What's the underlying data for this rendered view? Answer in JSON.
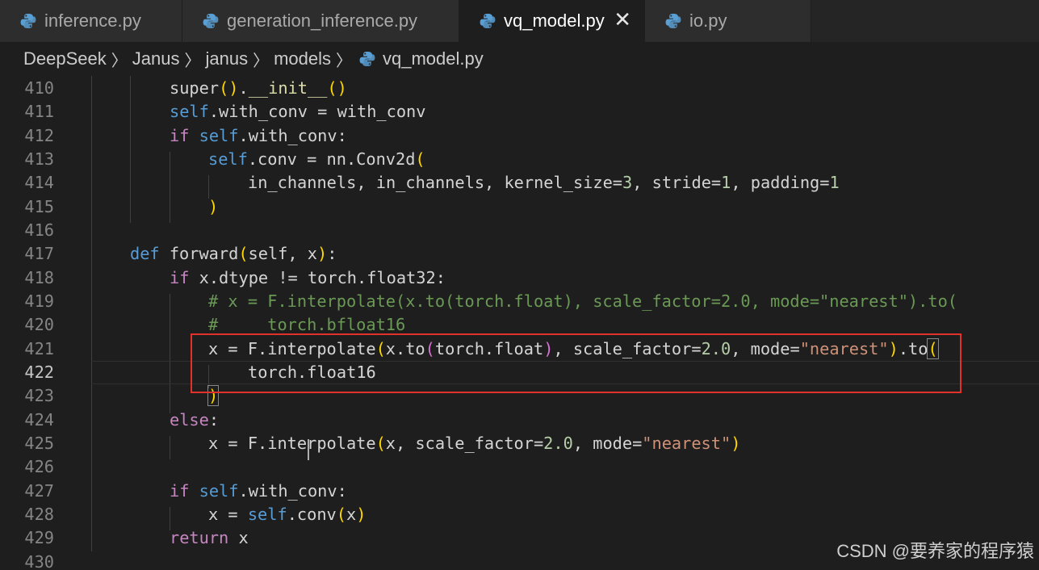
{
  "tabs": [
    {
      "label": "inference.py",
      "active": false
    },
    {
      "label": "generation_inference.py",
      "active": false
    },
    {
      "label": "vq_model.py",
      "active": true,
      "close": "✕"
    },
    {
      "label": "io.py",
      "active": false
    }
  ],
  "breadcrumb": [
    "DeepSeek",
    "Janus",
    "janus",
    "models",
    "vq_model.py"
  ],
  "icons": {
    "python_file": "python-file-icon",
    "chevron": "chevron-right-icon"
  },
  "editor": {
    "current_line": "422",
    "lines": [
      {
        "n": "410",
        "tokens": [
          [
            "p",
            "super"
          ],
          [
            "b1",
            "()"
          ],
          [
            "p",
            "."
          ],
          [
            "fn",
            "__init__"
          ],
          [
            "b1",
            "()"
          ]
        ]
      },
      {
        "n": "411",
        "tokens": [
          [
            "kw",
            "self"
          ],
          [
            "p",
            ".with_conv = with_conv"
          ]
        ]
      },
      {
        "n": "412",
        "tokens": [
          [
            "ctl",
            "if "
          ],
          [
            "kw",
            "self"
          ],
          [
            "p",
            ".with_conv:"
          ]
        ]
      },
      {
        "n": "413",
        "tokens": [
          [
            "kw",
            "self"
          ],
          [
            "p",
            ".conv = nn.Conv2d"
          ],
          [
            "b1",
            "("
          ]
        ]
      },
      {
        "n": "414",
        "tokens": [
          [
            "p",
            "in_channels, in_channels, kernel_size="
          ],
          [
            "num",
            "3"
          ],
          [
            "p",
            ", stride="
          ],
          [
            "num",
            "1"
          ],
          [
            "p",
            ", padding="
          ],
          [
            "num",
            "1"
          ]
        ]
      },
      {
        "n": "415",
        "tokens": [
          [
            "b1",
            ")"
          ]
        ]
      },
      {
        "n": "416",
        "tokens": []
      },
      {
        "n": "417",
        "tokens": [
          [
            "kw",
            "def "
          ],
          [
            "p",
            "forward"
          ],
          [
            "b1",
            "("
          ],
          [
            "p",
            "self, x"
          ],
          [
            "b1",
            ")"
          ],
          [
            "p",
            ":"
          ]
        ]
      },
      {
        "n": "418",
        "tokens": [
          [
            "ctl",
            "if "
          ],
          [
            "p",
            "x.dtype != torch.float32:"
          ]
        ]
      },
      {
        "n": "419",
        "tokens": [
          [
            "cmt",
            "# x = F.interpolate(x.to(torch.float), scale_factor=2.0, mode=\"nearest\").to("
          ]
        ]
      },
      {
        "n": "420",
        "tokens": [
          [
            "cmt",
            "#     torch.bfloat16"
          ]
        ]
      },
      {
        "n": "421",
        "tokens": [
          [
            "p",
            "x = F.interpolate"
          ],
          [
            "b1",
            "("
          ],
          [
            "p",
            "x.to"
          ],
          [
            "b2",
            "("
          ],
          [
            "p",
            "torch.float"
          ],
          [
            "b2",
            ")"
          ],
          [
            "p",
            ", scale_factor="
          ],
          [
            "num",
            "2.0"
          ],
          [
            "p",
            ", mode="
          ],
          [
            "str",
            "\"nearest\""
          ],
          [
            "b1",
            ")"
          ],
          [
            "p",
            ".to"
          ],
          [
            "b1m",
            "("
          ]
        ]
      },
      {
        "n": "422",
        "tokens": [
          [
            "p",
            "torch.float16"
          ]
        ]
      },
      {
        "n": "423",
        "tokens": [
          [
            "b1m",
            ")"
          ]
        ]
      },
      {
        "n": "424",
        "tokens": [
          [
            "ctl",
            "else"
          ],
          [
            "p",
            ":"
          ]
        ]
      },
      {
        "n": "425",
        "tokens": [
          [
            "p",
            "x = F.interpolate"
          ],
          [
            "b1",
            "("
          ],
          [
            "p",
            "x, scale_factor="
          ],
          [
            "num",
            "2.0"
          ],
          [
            "p",
            ", mode="
          ],
          [
            "str",
            "\"nearest\""
          ],
          [
            "b1",
            ")"
          ]
        ]
      },
      {
        "n": "426",
        "tokens": []
      },
      {
        "n": "427",
        "tokens": [
          [
            "ctl",
            "if "
          ],
          [
            "kw",
            "self"
          ],
          [
            "p",
            ".with_conv:"
          ]
        ]
      },
      {
        "n": "428",
        "tokens": [
          [
            "p",
            "x = "
          ],
          [
            "kw",
            "self"
          ],
          [
            "p",
            ".conv"
          ],
          [
            "b1",
            "("
          ],
          [
            "p",
            "x"
          ],
          [
            "b1",
            ")"
          ]
        ]
      },
      {
        "n": "429",
        "tokens": [
          [
            "ctl",
            "return "
          ],
          [
            "p",
            "x"
          ]
        ]
      },
      {
        "n": "430",
        "tokens": []
      }
    ]
  },
  "watermark": "CSDN @要养家的程序猿"
}
